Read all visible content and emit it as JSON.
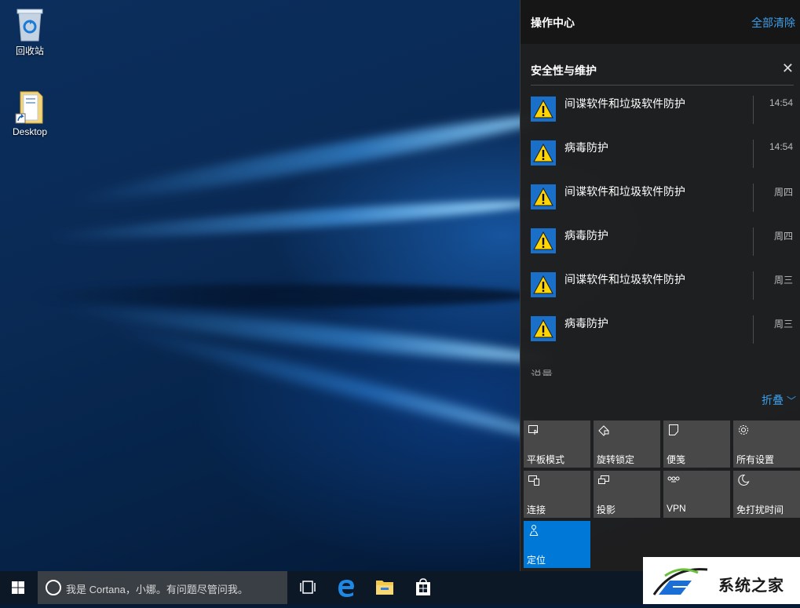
{
  "desktop": {
    "icons": [
      {
        "label": "回收站",
        "icon": "recycle-bin-icon"
      },
      {
        "label": "Desktop",
        "icon": "folder-shortcut-icon"
      }
    ]
  },
  "action_center": {
    "title": "操作中心",
    "clear_all": "全部清除",
    "group": {
      "title": "安全性与维护",
      "close": "✕"
    },
    "notifications": [
      {
        "text": "间谍软件和垃圾软件防护",
        "time": "14:54",
        "icon": "warning-icon"
      },
      {
        "text": "病毒防护",
        "time": "14:54",
        "icon": "warning-icon"
      },
      {
        "text": "间谍软件和垃圾软件防护",
        "time": "周四",
        "icon": "warning-icon"
      },
      {
        "text": "病毒防护",
        "time": "周四",
        "icon": "warning-icon"
      },
      {
        "text": "间谍软件和垃圾软件防护",
        "time": "周三",
        "icon": "warning-icon"
      },
      {
        "text": "病毒防护",
        "time": "周三",
        "icon": "warning-icon"
      }
    ],
    "cutoff_text": "说量",
    "collapse": "折叠",
    "quick_actions": [
      {
        "label": "平板模式",
        "icon": "tablet-mode-icon",
        "active": false
      },
      {
        "label": "旋转锁定",
        "icon": "rotation-lock-icon",
        "active": false
      },
      {
        "label": "便笺",
        "icon": "note-icon",
        "active": false
      },
      {
        "label": "所有设置",
        "icon": "settings-gear-icon",
        "active": false
      },
      {
        "label": "连接",
        "icon": "connect-icon",
        "active": false
      },
      {
        "label": "投影",
        "icon": "project-icon",
        "active": false
      },
      {
        "label": "VPN",
        "icon": "vpn-icon",
        "active": false
      },
      {
        "label": "免打扰时间",
        "icon": "quiet-hours-moon-icon",
        "active": false
      },
      {
        "label": "定位",
        "icon": "location-icon",
        "active": true
      }
    ]
  },
  "taskbar": {
    "search_placeholder": "我是 Cortana，小娜。有问题尽管问我。",
    "apps": [
      "task-view-icon",
      "edge-icon",
      "file-explorer-icon",
      "store-icon"
    ]
  },
  "watermark": {
    "text": "系统之家"
  },
  "colors": {
    "accent": "#0078d7",
    "link": "#3d9ee9",
    "tile": "#484848",
    "panel": "#1f1f1f"
  }
}
